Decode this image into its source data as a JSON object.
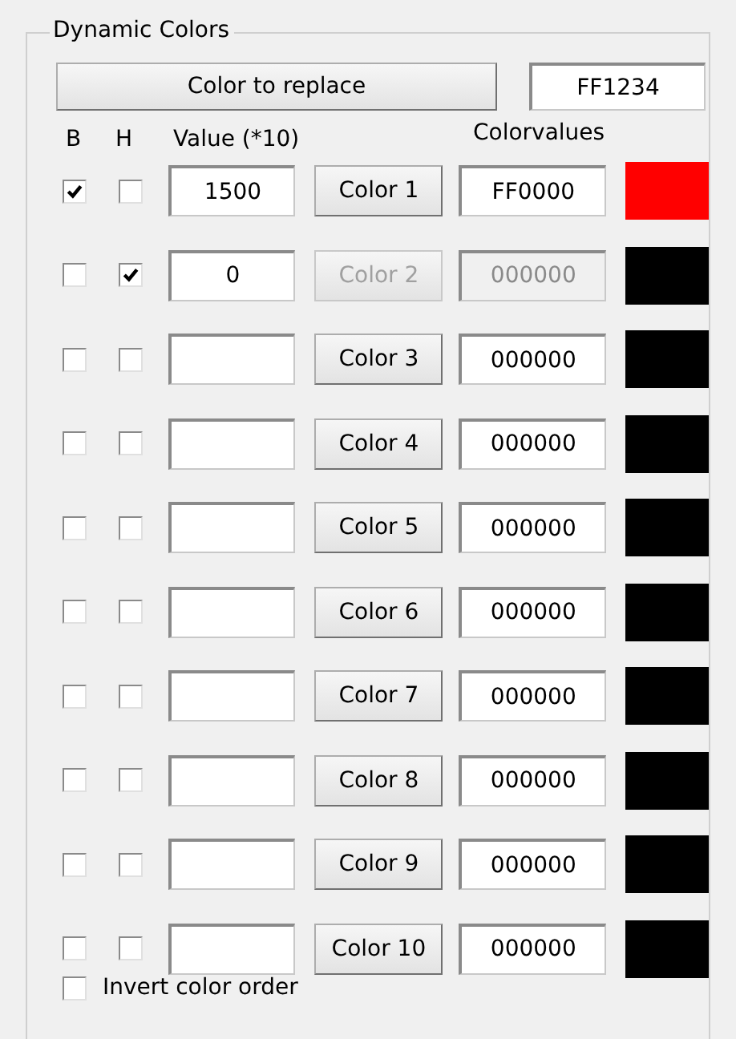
{
  "group": {
    "title": "Dynamic Colors"
  },
  "replace": {
    "button": "Color to replace",
    "value": "FF1234"
  },
  "headers": {
    "b": "B",
    "h": "H",
    "value": "Value (*10)",
    "colorvalues": "Colorvalues"
  },
  "rows": [
    {
      "b": true,
      "h": false,
      "value": "1500",
      "button": "Color 1",
      "colorvalue": "FF0000",
      "color": "#ff0000",
      "disabled": false
    },
    {
      "b": false,
      "h": true,
      "value": "0",
      "button": "Color 2",
      "colorvalue": "000000",
      "color": "#000000",
      "disabled": true
    },
    {
      "b": false,
      "h": false,
      "button": "Color 3",
      "colorvalue": "000000",
      "color": "#000000",
      "disabled": false
    },
    {
      "b": false,
      "h": false,
      "button": "Color 4",
      "colorvalue": "000000",
      "color": "#000000",
      "disabled": false
    },
    {
      "b": false,
      "h": false,
      "button": "Color 5",
      "colorvalue": "000000",
      "color": "#000000",
      "disabled": false
    },
    {
      "b": false,
      "h": false,
      "button": "Color 6",
      "colorvalue": "000000",
      "color": "#000000",
      "disabled": false
    },
    {
      "b": false,
      "h": false,
      "button": "Color 7",
      "colorvalue": "000000",
      "color": "#000000",
      "disabled": false
    },
    {
      "b": false,
      "h": false,
      "button": "Color 8",
      "colorvalue": "000000",
      "color": "#000000",
      "disabled": false
    },
    {
      "b": false,
      "h": false,
      "button": "Color 9",
      "colorvalue": "000000",
      "color": "#000000",
      "disabled": false
    },
    {
      "b": false,
      "h": false,
      "button": "Color 10",
      "colorvalue": "000000",
      "color": "#000000",
      "disabled": false
    }
  ],
  "invert": {
    "label": "Invert color order",
    "checked": false
  }
}
